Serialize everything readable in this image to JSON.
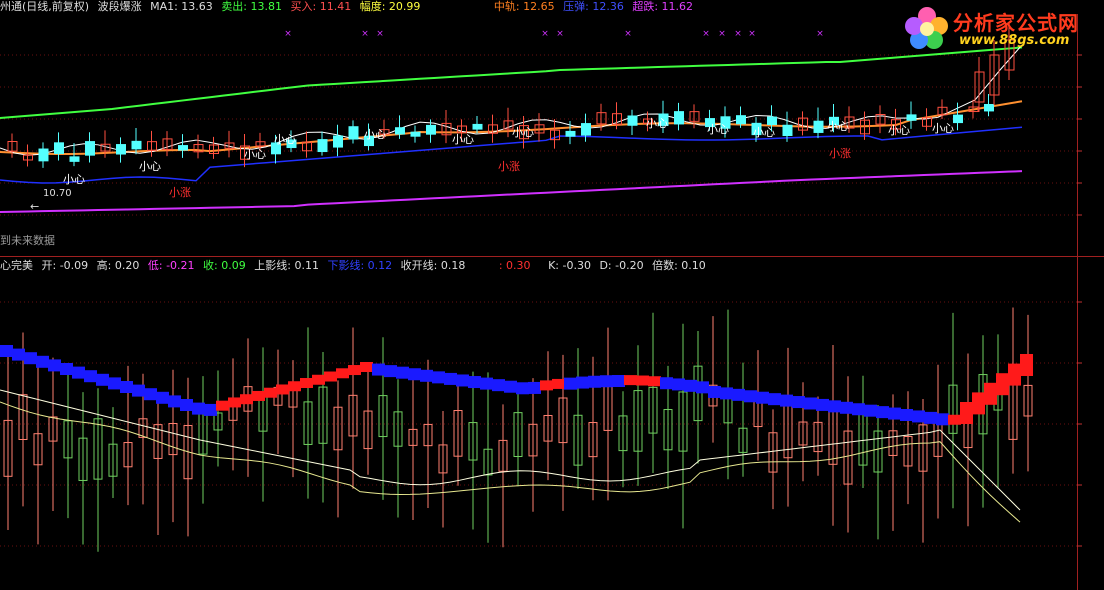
{
  "price_header": {
    "stock": "州通(日线,前复权)",
    "formula": "波段爆涨",
    "ma1": "MA1: 13.63",
    "sell": "卖出: 13.81",
    "buy": "买入: 11.41",
    "amplitude": "幅度: 20.99",
    "middle": "中轨: 12.65",
    "pressure": "压弹: 12.36",
    "breakout": "超跌: 11.62"
  },
  "indicator_header": {
    "name": "心完美",
    "open": "开: -0.09",
    "high": "高: 0.20",
    "low": "低: -0.21",
    "close": "收: 0.09",
    "upper_shadow": "上影线: 0.11",
    "lower_shadow": "下影线: 0.12",
    "open_close": "收开线: 0.18",
    "val": ": 0.30",
    "k": "K: -0.30",
    "d": "D: -0.20",
    "multiple": "倍数: 0.10"
  },
  "logo": {
    "title": "分析家公式网",
    "url": "www.88gs.com"
  },
  "labels": {
    "future_data": "到未来数据",
    "current_price": "10.70",
    "arrow": "←",
    "xiaoxin": "小心",
    "xiaozhang": "小涨"
  },
  "colors": {
    "background": "#000000",
    "up": "#ff5040",
    "down": "#54ffff",
    "green_band": "#40ff40",
    "orange_line": "#ff9030",
    "blue_line": "#2030ff",
    "magenta_line": "#d030ff",
    "white_line": "#ffffff",
    "red_label": "#ff3030"
  }
}
